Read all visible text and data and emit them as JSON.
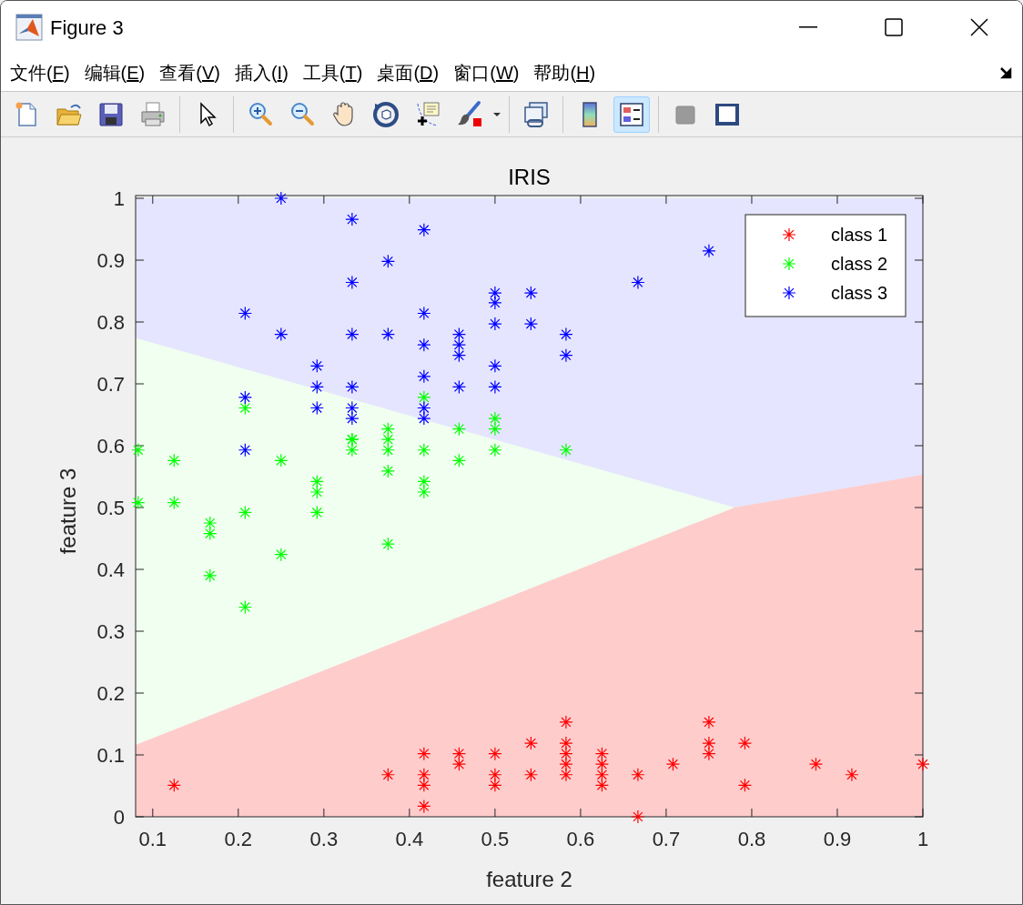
{
  "window": {
    "title": "Figure 3"
  },
  "menu": [
    {
      "before": "文件(",
      "key": "F",
      "after": ")"
    },
    {
      "before": "编辑(",
      "key": "E",
      "after": ")"
    },
    {
      "before": "查看(",
      "key": "V",
      "after": ")"
    },
    {
      "before": "插入(",
      "key": "I",
      "after": ")"
    },
    {
      "before": "工具(",
      "key": "T",
      "after": ")"
    },
    {
      "before": "桌面(",
      "key": "D",
      "after": ")"
    },
    {
      "before": "窗口(",
      "key": "W",
      "after": ")"
    },
    {
      "before": "帮助(",
      "key": "H",
      "after": ")"
    }
  ],
  "toolbar": {
    "groups": [
      [
        {
          "kind": "new",
          "selected": false
        },
        {
          "kind": "open",
          "selected": false
        },
        {
          "kind": "save",
          "selected": false
        },
        {
          "kind": "print",
          "selected": false
        }
      ],
      [
        {
          "kind": "pointer",
          "selected": false
        }
      ],
      [
        {
          "kind": "zoomin",
          "selected": false
        },
        {
          "kind": "zoomout",
          "selected": false
        },
        {
          "kind": "pan",
          "selected": false
        },
        {
          "kind": "rotate",
          "selected": false
        },
        {
          "kind": "datatip",
          "selected": false
        },
        {
          "kind": "brush",
          "selected": false
        },
        {
          "kind": "dropdown",
          "selected": false
        }
      ],
      [
        {
          "kind": "link",
          "selected": false
        }
      ],
      [
        {
          "kind": "colorbar",
          "selected": false
        },
        {
          "kind": "legend",
          "selected": true
        }
      ],
      [
        {
          "kind": "hide",
          "selected": false
        },
        {
          "kind": "dock",
          "selected": false
        }
      ]
    ]
  },
  "chart_data": {
    "type": "scatter",
    "title": "IRIS",
    "xlabel": "feature 2",
    "ylabel": "feature 3",
    "xlim": [
      0.08,
      1
    ],
    "legend": true,
    "ylim": [
      0,
      1
    ],
    "xticks": [
      0.1,
      0.2,
      0.3,
      0.4,
      0.5,
      0.6,
      0.7,
      0.8,
      0.9,
      {
        "value": 1,
        "label": "1"
      }
    ],
    "yticks": [
      {
        "value": 0,
        "label": "0"
      },
      0.1,
      0.2,
      0.3,
      0.4,
      0.5,
      0.6,
      0.7,
      0.8,
      0.9,
      {
        "value": 1,
        "label": "1"
      }
    ],
    "series": [
      {
        "name": "class 1",
        "color": "#ff0000",
        "x": [
          0.125,
          0.375,
          0.417,
          0.417,
          0.417,
          0.417,
          0.458,
          0.458,
          0.5,
          0.5,
          0.5,
          0.542,
          0.542,
          0.583,
          0.583,
          0.583,
          0.583,
          0.583,
          0.625,
          0.625,
          0.625,
          0.625,
          0.667,
          0.667,
          0.708,
          0.75,
          0.75,
          0.75,
          0.792,
          0.792,
          0.875,
          0.917,
          1.0
        ],
        "values": [
          0.051,
          0.068,
          0.102,
          0.068,
          0.051,
          0.017,
          0.102,
          0.085,
          0.102,
          0.068,
          0.051,
          0.119,
          0.068,
          0.153,
          0.119,
          0.102,
          0.085,
          0.068,
          0.102,
          0.085,
          0.068,
          0.051,
          0.068,
          0.0,
          0.085,
          0.153,
          0.119,
          0.102,
          0.119,
          0.051,
          0.085,
          0.068,
          0.085
        ]
      },
      {
        "name": "class 2",
        "color": "#00ff00",
        "x": [
          0.083,
          0.083,
          0.125,
          0.125,
          0.167,
          0.167,
          0.167,
          0.208,
          0.208,
          0.208,
          0.25,
          0.25,
          0.292,
          0.292,
          0.292,
          0.333,
          0.333,
          0.333,
          0.375,
          0.375,
          0.375,
          0.375,
          0.375,
          0.417,
          0.417,
          0.417,
          0.417,
          0.458,
          0.458,
          0.5,
          0.5,
          0.5,
          0.583
        ],
        "values": [
          0.593,
          0.508,
          0.576,
          0.508,
          0.475,
          0.458,
          0.39,
          0.661,
          0.492,
          0.339,
          0.576,
          0.424,
          0.542,
          0.525,
          0.492,
          0.61,
          0.593,
          0.61,
          0.627,
          0.61,
          0.593,
          0.559,
          0.441,
          0.678,
          0.593,
          0.542,
          0.525,
          0.627,
          0.576,
          0.644,
          0.627,
          0.593,
          0.593
        ]
      },
      {
        "name": "class 3",
        "color": "#0000ff",
        "x": [
          0.25,
          0.333,
          0.417,
          0.333,
          0.375,
          0.208,
          0.25,
          0.292,
          0.292,
          0.292,
          0.333,
          0.333,
          0.333,
          0.333,
          0.375,
          0.417,
          0.417,
          0.417,
          0.417,
          0.417,
          0.458,
          0.458,
          0.458,
          0.458,
          0.5,
          0.5,
          0.5,
          0.5,
          0.5,
          0.542,
          0.542,
          0.583,
          0.583,
          0.667,
          0.75,
          0.208,
          0.208
        ],
        "values": [
          1.0,
          0.966,
          0.949,
          0.864,
          0.898,
          0.814,
          0.78,
          0.729,
          0.695,
          0.661,
          0.78,
          0.695,
          0.661,
          0.644,
          0.78,
          0.814,
          0.763,
          0.712,
          0.661,
          0.644,
          0.78,
          0.763,
          0.746,
          0.695,
          0.847,
          0.831,
          0.797,
          0.729,
          0.695,
          0.847,
          0.797,
          0.78,
          0.746,
          0.864,
          0.915,
          0.678,
          0.593
        ]
      }
    ]
  }
}
